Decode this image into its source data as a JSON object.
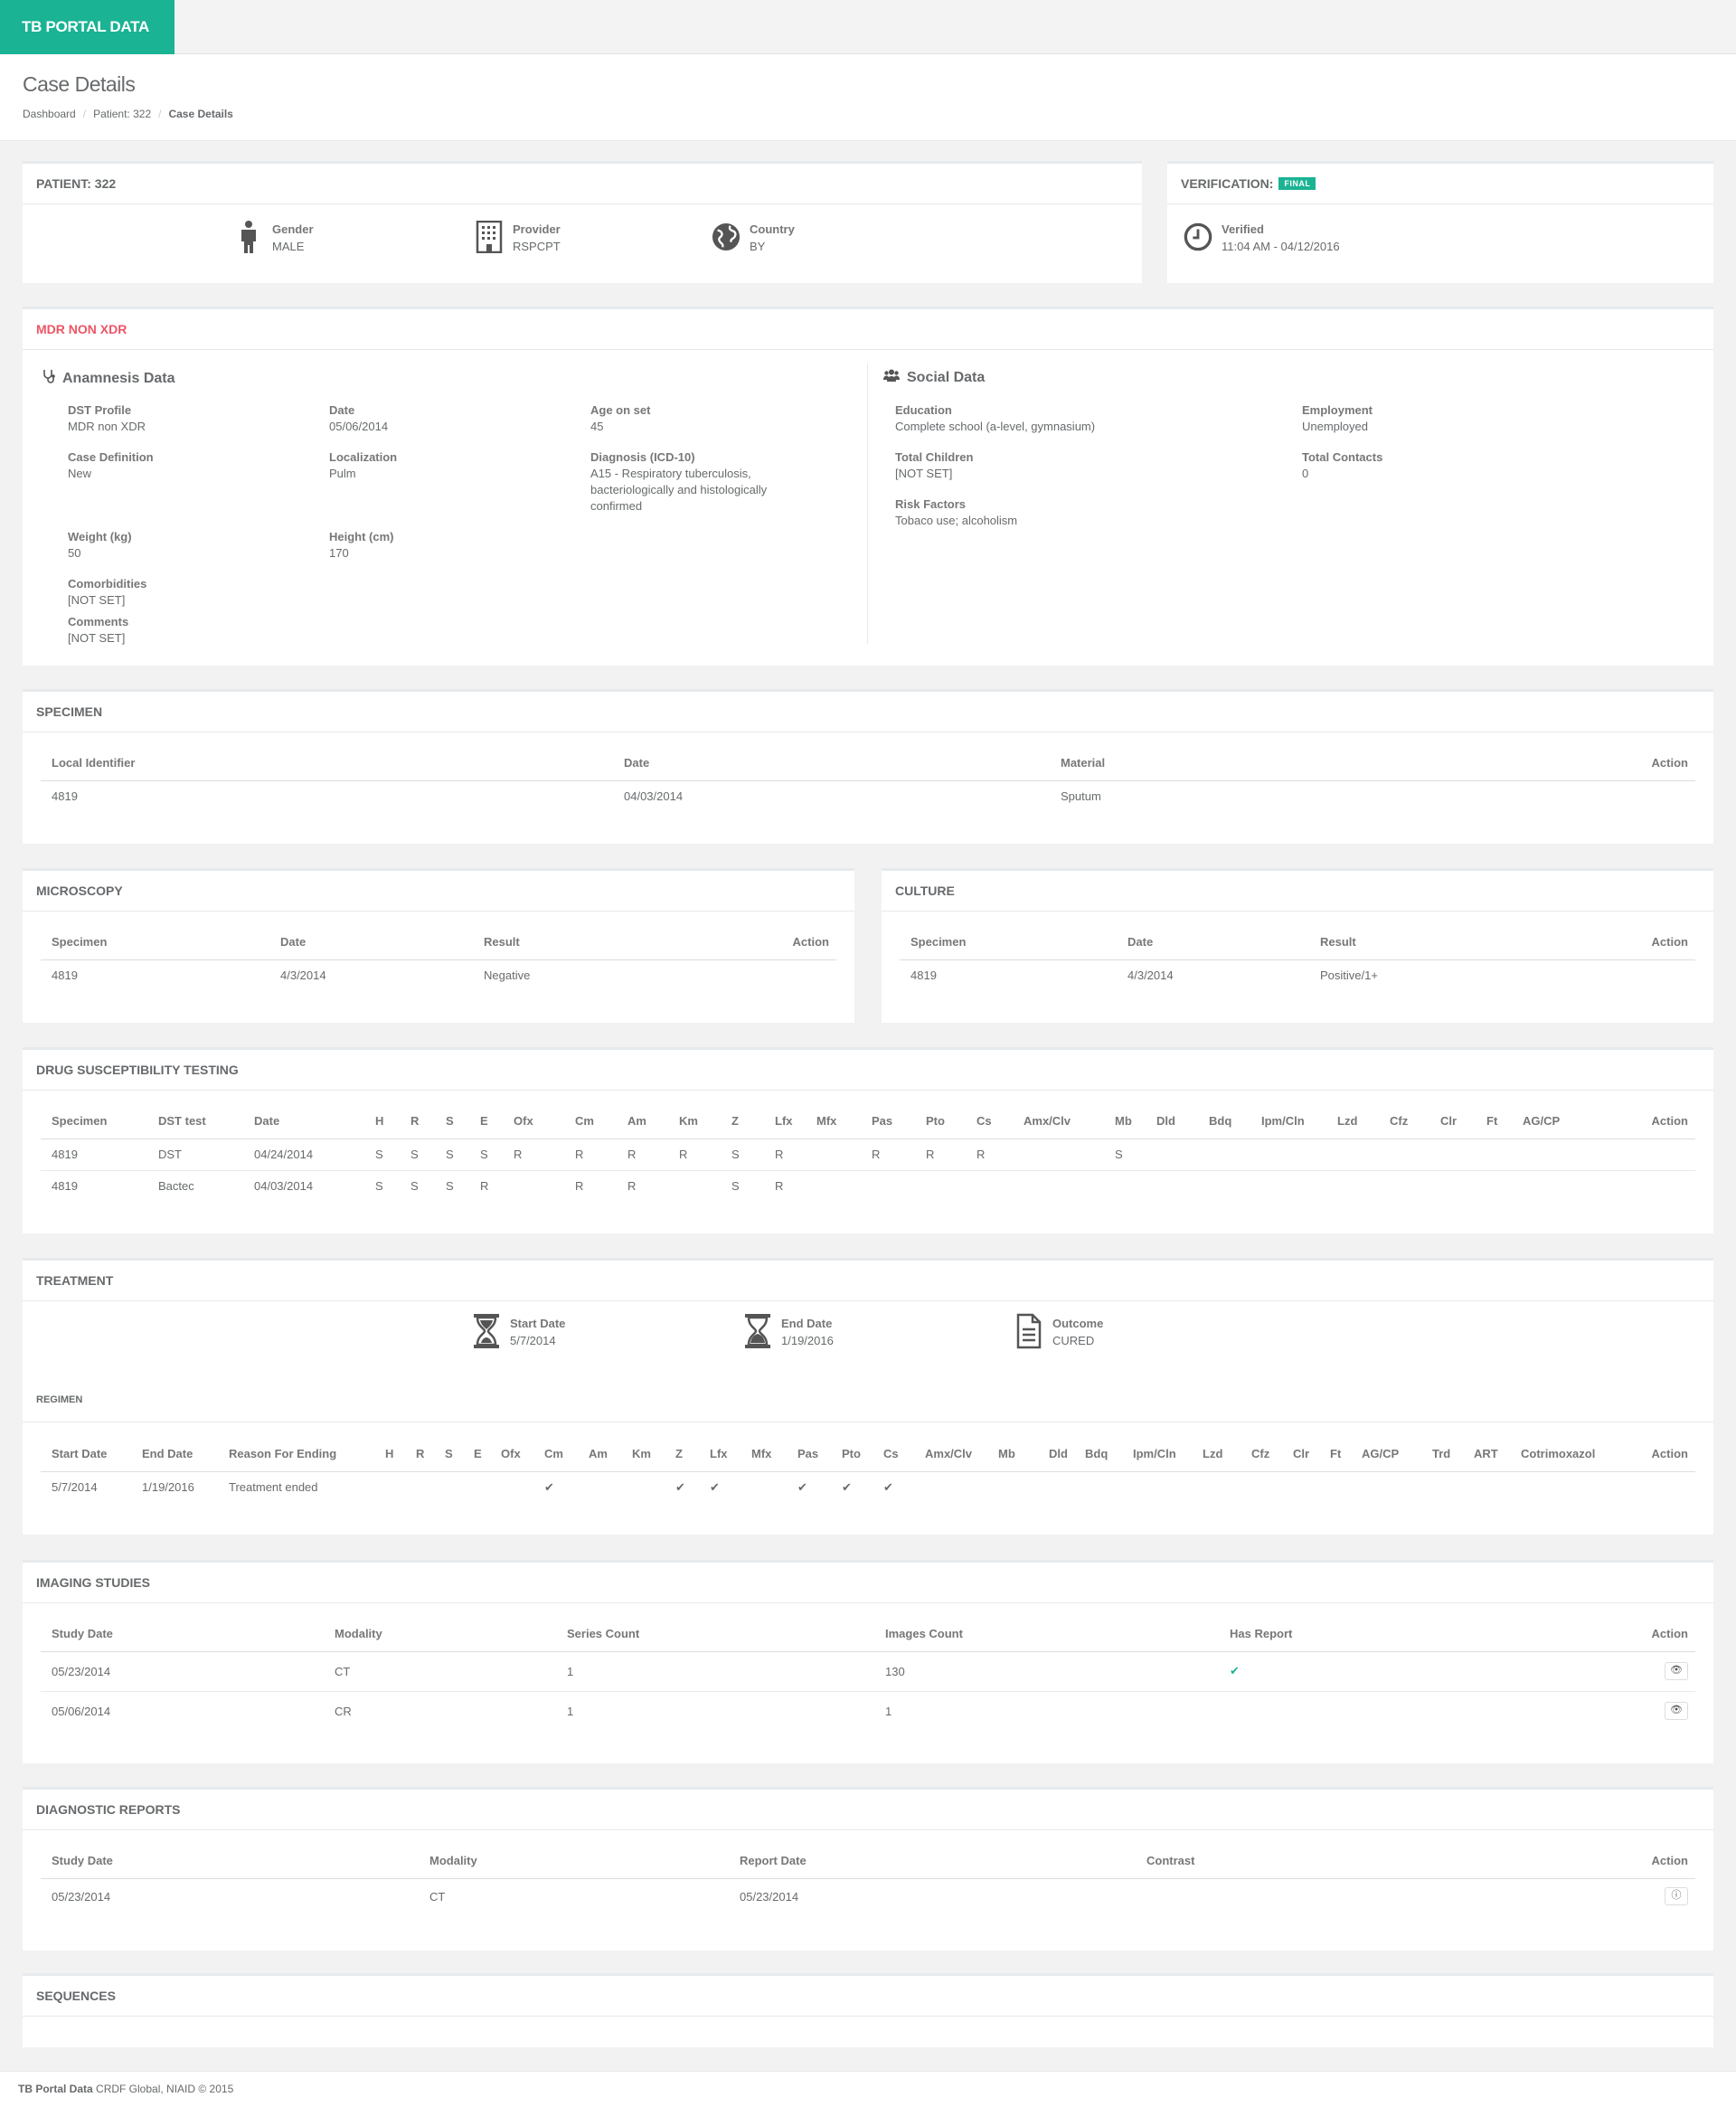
{
  "brand": "TB PORTAL DATA",
  "page_title": "Case Details",
  "breadcrumb": [
    "Dashboard",
    "Patient: 322",
    "Case Details"
  ],
  "patient": {
    "title": "PATIENT: 322",
    "gender_label": "Gender",
    "gender": "MALE",
    "provider_label": "Provider",
    "provider": "RSPCPT",
    "country_label": "Country",
    "country": "BY"
  },
  "verification": {
    "title": "VERIFICATION:",
    "badge": "FINAL",
    "verified_label": "Verified",
    "verified_value": "11:04 AM - 04/12/2016"
  },
  "case": {
    "title": "MDR NON XDR",
    "anamnesis_heading": "Anamnesis Data",
    "social_heading": "Social Data",
    "anamnesis": {
      "dst_profile_label": "DST Profile",
      "dst_profile": "MDR non XDR",
      "date_label": "Date",
      "date": "05/06/2014",
      "age_label": "Age on set",
      "age": "45",
      "case_def_label": "Case Definition",
      "case_def": "New",
      "localization_label": "Localization",
      "localization": "Pulm",
      "diagnosis_label": "Diagnosis (ICD-10)",
      "diagnosis": "A15 - Respiratory tuberculosis, bacteriologically and histologically confirmed",
      "weight_label": "Weight (kg)",
      "weight": "50",
      "height_label": "Height (cm)",
      "height": "170",
      "comorbidities_label": "Comorbidities",
      "comorbidities": "[NOT SET]",
      "comments_label": "Comments",
      "comments": "[NOT SET]"
    },
    "social": {
      "education_label": "Education",
      "education": "Complete school (a-level, gymnasium)",
      "employment_label": "Employment",
      "employment": "Unemployed",
      "children_label": "Total Children",
      "children": "[NOT SET]",
      "contacts_label": "Total Contacts",
      "contacts": "0",
      "risk_label": "Risk Factors",
      "risk": "Tobaco use; alcoholism"
    }
  },
  "specimen": {
    "title": "SPECIMEN",
    "headers": [
      "Local Identifier",
      "Date",
      "Material",
      "Action"
    ],
    "rows": [
      [
        "4819",
        "04/03/2014",
        "Sputum",
        ""
      ]
    ]
  },
  "microscopy": {
    "title": "MICROSCOPY",
    "headers": [
      "Specimen",
      "Date",
      "Result",
      "Action"
    ],
    "rows": [
      [
        "4819",
        "4/3/2014",
        "Negative",
        ""
      ]
    ]
  },
  "culture": {
    "title": "CULTURE",
    "headers": [
      "Specimen",
      "Date",
      "Result",
      "Action"
    ],
    "rows": [
      [
        "4819",
        "4/3/2014",
        "Positive/1+",
        ""
      ]
    ]
  },
  "dst": {
    "title": "DRUG SUSCEPTIBILITY TESTING",
    "headers": [
      "Specimen",
      "DST test",
      "Date",
      "H",
      "R",
      "S",
      "E",
      "Ofx",
      "Cm",
      "Am",
      "Km",
      "Z",
      "Lfx",
      "Mfx",
      "Pas",
      "Pto",
      "Cs",
      "Amx/Clv",
      "Mb",
      "Dld",
      "Bdq",
      "Ipm/Cln",
      "Lzd",
      "Cfz",
      "Clr",
      "Ft",
      "AG/CP",
      "Action"
    ],
    "rows": [
      [
        "4819",
        "DST",
        "04/24/2014",
        "S",
        "S",
        "S",
        "S",
        "R",
        "R",
        "R",
        "R",
        "S",
        "R",
        "",
        "R",
        "R",
        "R",
        "",
        "S",
        "",
        "",
        "",
        "",
        "",
        "",
        "",
        "",
        ""
      ],
      [
        "4819",
        "Bactec",
        "04/03/2014",
        "S",
        "S",
        "S",
        "R",
        "",
        "R",
        "R",
        "",
        "S",
        "R",
        "",
        "",
        "",
        "",
        "",
        "",
        "",
        "",
        "",
        "",
        "",
        "",
        "",
        "",
        ""
      ]
    ]
  },
  "treatment": {
    "title": "TREATMENT",
    "start_label": "Start Date",
    "start": "5/7/2014",
    "end_label": "End Date",
    "end": "1/19/2016",
    "outcome_label": "Outcome",
    "outcome": "CURED",
    "regimen_title": "REGIMEN",
    "headers": [
      "Start Date",
      "End Date",
      "Reason For Ending",
      "H",
      "R",
      "S",
      "E",
      "Ofx",
      "Cm",
      "Am",
      "Km",
      "Z",
      "Lfx",
      "Mfx",
      "Pas",
      "Pto",
      "Cs",
      "Amx/Clv",
      "Mb",
      "Dld",
      "Bdq",
      "Ipm/Cln",
      "Lzd",
      "Cfz",
      "Clr",
      "Ft",
      "AG/CP",
      "Trd",
      "ART",
      "Cotrimoxazol",
      "Action"
    ],
    "rows": [
      [
        "5/7/2014",
        "1/19/2016",
        "Treatment ended",
        "",
        "",
        "",
        "",
        "",
        "✔",
        "",
        "",
        "✔",
        "✔",
        "",
        "✔",
        "✔",
        "✔",
        "",
        "",
        "",
        "",
        "",
        "",
        "",
        "",
        "",
        "",
        "",
        "",
        "",
        ""
      ]
    ]
  },
  "imaging": {
    "title": "IMAGING STUDIES",
    "headers": [
      "Study Date",
      "Modality",
      "Series Count",
      "Images Count",
      "Has Report",
      "Action"
    ],
    "rows": [
      [
        "05/23/2014",
        "CT",
        "1",
        "130",
        "✔",
        ""
      ],
      [
        "05/06/2014",
        "CR",
        "1",
        "1",
        "",
        ""
      ]
    ]
  },
  "reports": {
    "title": "DIAGNOSTIC REPORTS",
    "headers": [
      "Study Date",
      "Modality",
      "Report Date",
      "Contrast",
      "Action"
    ],
    "rows": [
      [
        "05/23/2014",
        "CT",
        "05/23/2014",
        "",
        ""
      ]
    ]
  },
  "sequences": {
    "title": "SEQUENCES"
  },
  "footer": {
    "brand": "TB Portal Data",
    "text": " CRDF Global, NIAID © 2015"
  },
  "icons": {
    "gender": "male-icon",
    "provider": "building-icon",
    "country": "globe-icon",
    "verified": "clock-icon",
    "anamnesis": "stethoscope-icon",
    "social": "users-icon",
    "start": "hourglass-start-icon",
    "end": "hourglass-end-icon",
    "outcome": "document-icon",
    "view": "eye-icon",
    "info": "info-icon"
  },
  "colors": {
    "accent": "#1ab394",
    "danger": "#ed5565"
  }
}
